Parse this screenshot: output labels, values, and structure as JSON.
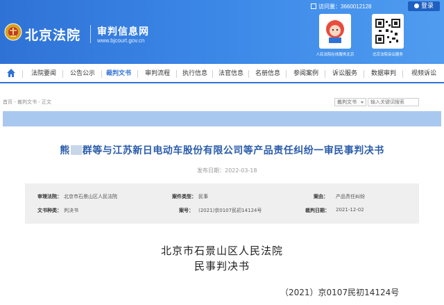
{
  "header": {
    "logo_text": "北京法院",
    "subtitle": "审判信息网",
    "url": "www.bjcourt.gov.cn",
    "visits_label": "访问量：3660012128",
    "login_label": "登录",
    "qr_captions": [
      "人民法院在线服务北京",
      "北京法院诉讼服务"
    ]
  },
  "nav": {
    "items": [
      {
        "label": "法院要闻"
      },
      {
        "label": "公告公示"
      },
      {
        "label": "裁判文书"
      },
      {
        "label": "审判流程"
      },
      {
        "label": "执行信息"
      },
      {
        "label": "法官信息"
      },
      {
        "label": "名册信息"
      },
      {
        "label": "参阅案例"
      },
      {
        "label": "诉讼服务"
      },
      {
        "label": "数据审判"
      },
      {
        "label": "视频诉讼"
      }
    ],
    "active_label": "裁判文书"
  },
  "breadcrumb": "首页 - 裁判文书 - 正文",
  "search": {
    "category": "裁判文书",
    "placeholder": "输入关键词搜索"
  },
  "document": {
    "title_a": "熊",
    "title_b": "群等与江苏新日电动车股份有限公司等产品责任纠纷一审民事判决书",
    "publish_date": "发布日期：2022-03-18",
    "court_name": "北京市石景山区人民法院",
    "doc_type": "民事判决书",
    "case_number_display": "（2021）京0107民初14124号"
  },
  "info": {
    "court_label": "审理法院：",
    "court_value": "北京市石景山区人民法院",
    "case_type_label": "案件类型：",
    "case_type_value": "民事",
    "cause_label": "案由：",
    "cause_value": "产品责任纠纷",
    "doc_type_label": "文书种类：",
    "doc_type_value": "判决书",
    "case_no_label": "案号：",
    "case_no_value": "(2021)京0107民初14124号",
    "judge_date_label": "裁判日期：",
    "judge_date_value": "2021-12-02"
  },
  "colors": {
    "header_blue": "#3a86e6",
    "title_blue": "#2a5cab",
    "strip_blue": "#a9c8f0"
  }
}
